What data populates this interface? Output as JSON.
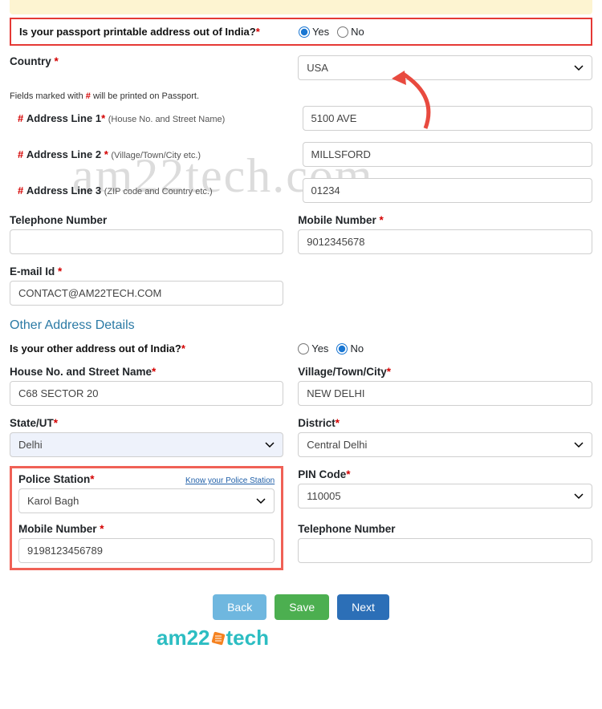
{
  "topQuestion": {
    "label": "Is your passport printable address out of India?",
    "yes": "Yes",
    "no": "No",
    "selected": "yes"
  },
  "country": {
    "label": "Country",
    "value": "USA"
  },
  "fieldsNote": "Fields marked with # will be printed on Passport.",
  "address": {
    "line1Label": "Address Line 1",
    "line1Sub": "(House No. and Street Name)",
    "line1": "5100 AVE",
    "line2Label": "Address Line 2",
    "line2Sub": "(Village/Town/City etc.)",
    "line2": "MILLSFORD",
    "line3Label": "Address Line 3",
    "line3Sub": "(ZIP code and Country etc.)",
    "line3": "01234"
  },
  "telephone": {
    "label": "Telephone Number",
    "value": ""
  },
  "mobile": {
    "label": "Mobile Number",
    "value": "9012345678"
  },
  "email": {
    "label": "E-mail Id",
    "value": "CONTACT@AM22TECH.COM"
  },
  "otherSection": "Other Address Details",
  "otherQuestion": {
    "label": "Is your other address out of India?",
    "yes": "Yes",
    "no": "No",
    "selected": "no"
  },
  "other": {
    "houseLabel": "House No. and Street Name",
    "house": "C68 SECTOR 20",
    "villageLabel": "Village/Town/City",
    "village": "NEW DELHI",
    "stateLabel": "State/UT",
    "state": "Delhi",
    "districtLabel": "District",
    "district": "Central Delhi",
    "policeLabel": "Police Station",
    "policeLink": "Know your Police Station",
    "police": "Karol Bagh",
    "pinLabel": "PIN Code",
    "pin": "110005",
    "mobileLabel": "Mobile Number",
    "mobile": "9198123456789",
    "telLabel": "Telephone Number",
    "tel": ""
  },
  "buttons": {
    "back": "Back",
    "save": "Save",
    "next": "Next"
  },
  "watermark": "am22tech.com",
  "logoText": {
    "a": "am22",
    "b": "tech"
  }
}
